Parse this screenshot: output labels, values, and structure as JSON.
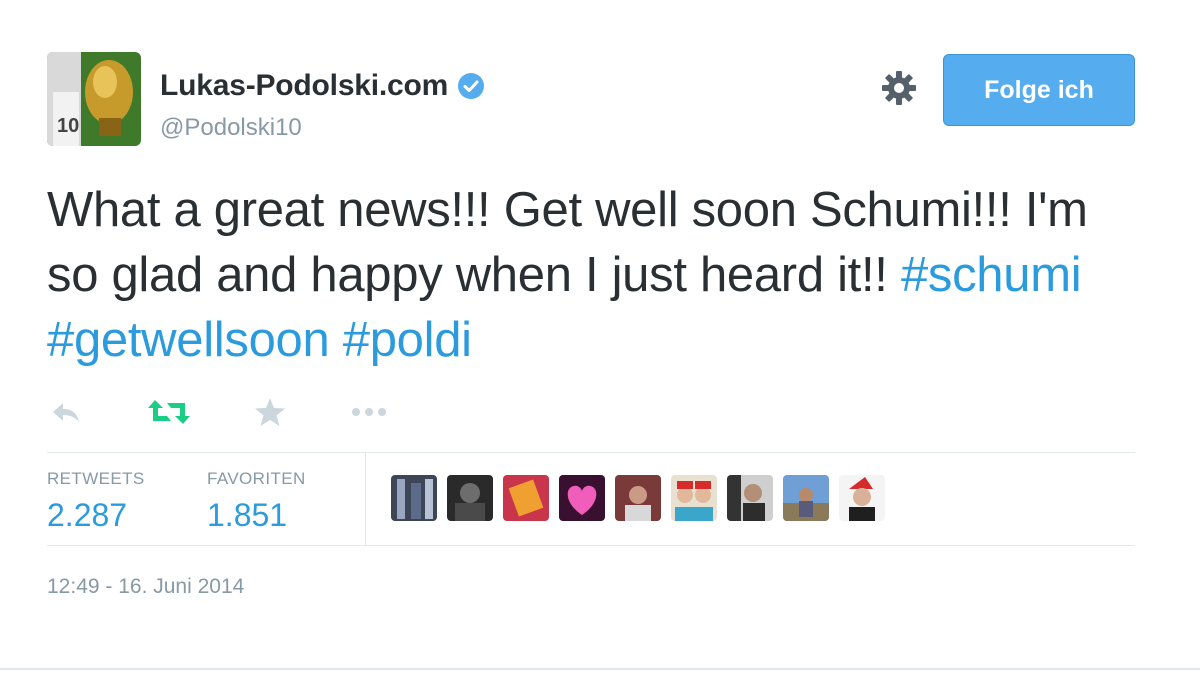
{
  "tweet": {
    "display_name": "Lukas-Podolski.com",
    "screen_name": "@Podolski10",
    "verified": true,
    "follow_button_label": "Folge ich",
    "text_before": "What a great news!!! Get well soon Schumi!!! I'm so glad and happy when I just heard it!! ",
    "hashtags": [
      "#schumi",
      "#getwellsoon",
      "#poldi"
    ],
    "timestamp": "12:49 - 16. Juni 2014"
  },
  "stats": {
    "retweets_label": "RETWEETS",
    "retweets_value": "2.287",
    "favorites_label": "FAVORITEN",
    "favorites_value": "1.851"
  },
  "actions": [
    "reply-icon",
    "retweet-icon",
    "favorite-icon",
    "more-icon"
  ],
  "colors": {
    "accent": "#55acee",
    "link": "#2b9bde",
    "retweet_active": "#19cf86",
    "muted": "#8899a6",
    "text": "#292f33"
  }
}
